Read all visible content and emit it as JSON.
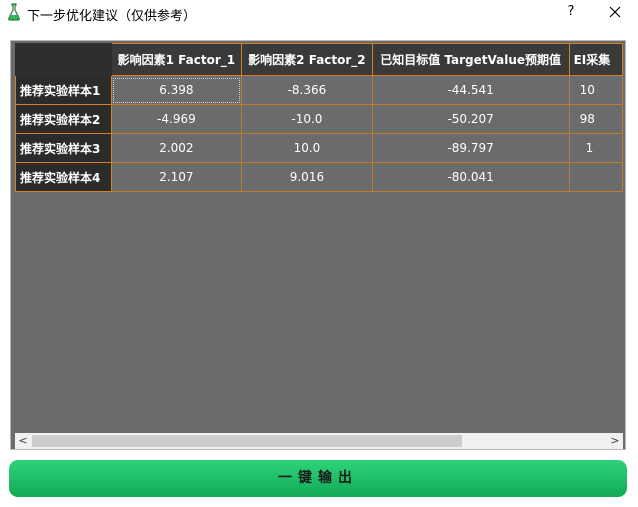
{
  "window": {
    "title": "下一步优化建议（仅供参考）",
    "help_label": "?",
    "icon": "flask-icon",
    "close_icon": "close-icon"
  },
  "table": {
    "columns": [
      "影响因素1 Factor_1",
      "影响因素2 Factor_2",
      "已知目标值 TargetValue预期值",
      "EI采集"
    ],
    "rows": [
      {
        "label": "推荐实验样本1",
        "cells": [
          "6.398",
          "-8.366",
          "-44.541",
          "10"
        ]
      },
      {
        "label": "推荐实验样本2",
        "cells": [
          "-4.969",
          "-10.0",
          "-50.207",
          "98"
        ]
      },
      {
        "label": "推荐实验样本3",
        "cells": [
          "2.002",
          "10.0",
          "-89.797",
          "1"
        ]
      },
      {
        "label": "推荐实验样本4",
        "cells": [
          "2.107",
          "9.016",
          "-80.041",
          ""
        ]
      }
    ]
  },
  "scrollbar": {
    "left_arrow": "<",
    "right_arrow": ">"
  },
  "export_button": {
    "label": "一键输出",
    "color": "#1fbf68"
  },
  "colors": {
    "grid_background": "#6b6b6b",
    "header_background": "#3a3a3a",
    "cell_border": "#d0822a"
  }
}
